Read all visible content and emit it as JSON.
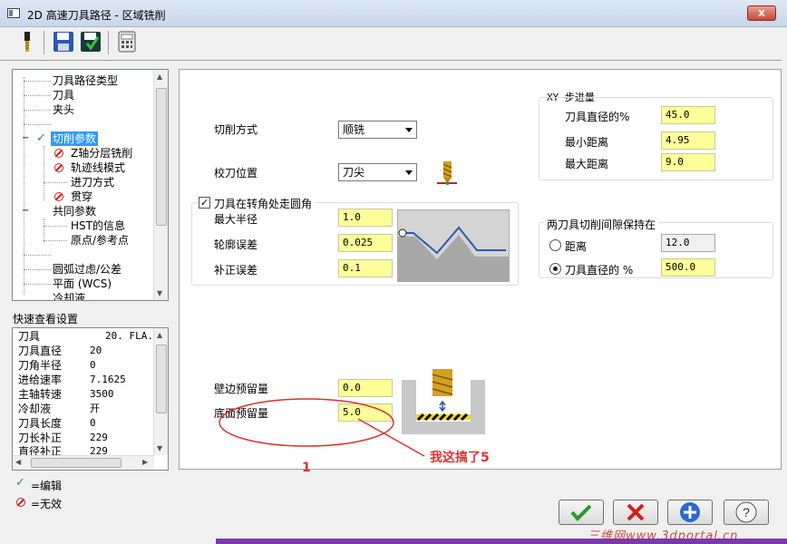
{
  "window": {
    "title": "2D 高速刀具路径 - 区域铣削",
    "close_label": "x"
  },
  "tree": {
    "items": [
      {
        "label": "刀具路径类型"
      },
      {
        "label": "刀具"
      },
      {
        "label": "夹头"
      },
      {
        "label": "切削参数"
      },
      {
        "label": "Z轴分层铣削"
      },
      {
        "label": "轨迹线模式"
      },
      {
        "label": "进刀方式"
      },
      {
        "label": "贯穿"
      },
      {
        "label": "共同参数"
      },
      {
        "label": "HST的信息"
      },
      {
        "label": "原点/参考点"
      },
      {
        "label": "圆弧过虑/公差"
      },
      {
        "label": "平面 (WCS)"
      },
      {
        "label": "冷却液"
      }
    ]
  },
  "quick": {
    "label": "快速查看设置",
    "rows": [
      {
        "k": "刀具",
        "v": "20. FLA..."
      },
      {
        "k": "刀具直径",
        "v": "20"
      },
      {
        "k": "刀角半径",
        "v": "0"
      },
      {
        "k": "进给速率",
        "v": "7.1625"
      },
      {
        "k": "主轴转速",
        "v": "3500"
      },
      {
        "k": "冷却液",
        "v": "开"
      },
      {
        "k": "刀具长度",
        "v": "0"
      },
      {
        "k": "刀长补正",
        "v": "229"
      },
      {
        "k": "直径补正",
        "v": "229"
      }
    ]
  },
  "legend": {
    "edited": "=编辑",
    "invalid": "=无效"
  },
  "params": {
    "cut_method_label": "切削方式",
    "cut_method_value": "顺铣",
    "tool_pos_label": "校刀位置",
    "tool_pos_value": "刀尖",
    "corner_round_label": "刀具在转角处走圆角",
    "max_radius_label": "最大半径",
    "max_radius_value": "1.0",
    "profile_tol_label": "轮廓误差",
    "profile_tol_value": "0.025",
    "offset_tol_label": "补正误差",
    "offset_tol_value": "0.1",
    "xy_step_title": "XY 步进量",
    "tool_dia_pct_label": "刀具直径的%",
    "tool_dia_pct_value": "45.0",
    "min_dist_label": "最小距离",
    "min_dist_value": "4.95",
    "max_dist_label": "最大距离",
    "max_dist_value": "9.0",
    "gap_title": "两刀具切削间隙保持在",
    "dist_label": "距离",
    "dist_value": "12.0",
    "tool_dia_pct2_label": "刀具直径的 %",
    "tool_dia_pct2_value": "500.0",
    "wall_stock_label": "壁边预留量",
    "wall_stock_value": "0.0",
    "floor_stock_label": "底面预留量",
    "floor_stock_value": "5.0",
    "annotation": "我这搞了5",
    "annotation_num": "1"
  },
  "watermark": "三维网www.3dportal.cn",
  "colors": {
    "annotation": "#e03030",
    "input_bg": "#ffff99",
    "selection": "#3399ff"
  }
}
